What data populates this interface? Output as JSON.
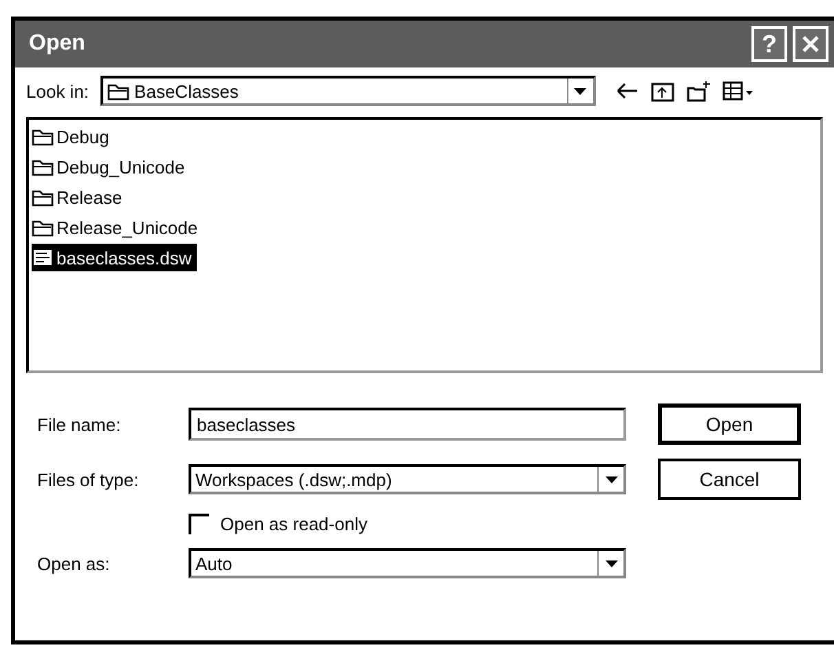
{
  "window": {
    "title": "Open",
    "help": "?"
  },
  "look_in": {
    "label": "Look in:",
    "value": "BaseClasses"
  },
  "files": [
    {
      "name": "Debug",
      "kind": "folder",
      "selected": false
    },
    {
      "name": "Debug_Unicode",
      "kind": "folder",
      "selected": false
    },
    {
      "name": "Release",
      "kind": "folder",
      "selected": false
    },
    {
      "name": "Release_Unicode",
      "kind": "folder",
      "selected": false
    },
    {
      "name": "baseclasses.dsw",
      "kind": "workspace",
      "selected": true
    }
  ],
  "file_name": {
    "label": "File name:",
    "value": "baseclasses"
  },
  "files_of_type": {
    "label": "Files of type:",
    "value": "Workspaces (.dsw;.mdp)"
  },
  "read_only": {
    "label": "Open as read-only",
    "checked": false
  },
  "open_as": {
    "label": "Open as:",
    "value": "Auto"
  },
  "buttons": [
    "Open",
    "Cancel"
  ]
}
